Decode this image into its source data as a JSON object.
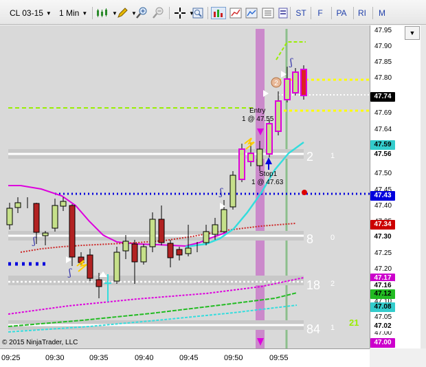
{
  "toolbar": {
    "instrument": "CL 03-15",
    "interval": "1 Min",
    "letters": [
      "ST",
      "F",
      "PA",
      "RI",
      "M"
    ]
  },
  "chart": {
    "copyright": "© 2015 NinjaTrader, LLC",
    "time_labels": [
      "09:25",
      "09:30",
      "09:35",
      "09:40",
      "09:45",
      "09:50",
      "09:55"
    ],
    "price_ticks": [
      "47.95",
      "47.90",
      "47.85",
      "47.80",
      "47.74",
      "47.69",
      "47.64",
      "47.59",
      "47.55",
      "47.50",
      "47.45",
      "47.40",
      "47.35",
      "47.30",
      "47.25",
      "47.20",
      "47.15",
      "47.10",
      "47.05",
      "47.00"
    ],
    "price_boxes": [
      {
        "label": "47.74",
        "bg": "#000000",
        "fg": "#ffffff"
      },
      {
        "label": "47.59",
        "bg": "#33cccc",
        "fg": "#000000"
      },
      {
        "label": "47.56",
        "bg": "#ffffff",
        "fg": "#000000"
      },
      {
        "label": "47.43",
        "bg": "#0000dd",
        "fg": "#ffffff"
      },
      {
        "label": "47.34",
        "bg": "#cc0000",
        "fg": "#ffffff"
      },
      {
        "label": "47.30",
        "bg": "#ffffff",
        "fg": "#000000"
      },
      {
        "label": "47.17",
        "bg": "#cc00cc",
        "fg": "#ffffff"
      },
      {
        "label": "47.16",
        "bg": "#ffffff",
        "fg": "#000000"
      },
      {
        "label": "47.12",
        "bg": "#22bb22",
        "fg": "#000000"
      },
      {
        "label": "47.08",
        "bg": "#33cccc",
        "fg": "#000000"
      },
      {
        "label": "47.02",
        "bg": "#ffffff",
        "fg": "#000000"
      },
      {
        "label": "47.00",
        "bg": "#cc00cc",
        "fg": "#ffffff"
      }
    ],
    "levels": [
      {
        "big": "2",
        "small": "1"
      },
      {
        "big": "8",
        "small": "0"
      },
      {
        "big": "18",
        "small": "2"
      },
      {
        "big": "84",
        "small": "1"
      }
    ],
    "green_count": "21",
    "entry_label": "Entry",
    "entry_detail": "1 @ 47.55",
    "stop_label": "Stop1",
    "stop_detail": "1 @ 47.63",
    "marker_number": "2",
    "colors": {
      "bg": "#d9d9d9",
      "up_candle": "#c6e08a",
      "down_candle": "#b22222",
      "magenta": "#cc00cc",
      "cyan": "#33dddd",
      "blue_dots": "#0000dd",
      "yellow_dots": "#ffff00",
      "green_dash": "#99ee00"
    }
  }
}
